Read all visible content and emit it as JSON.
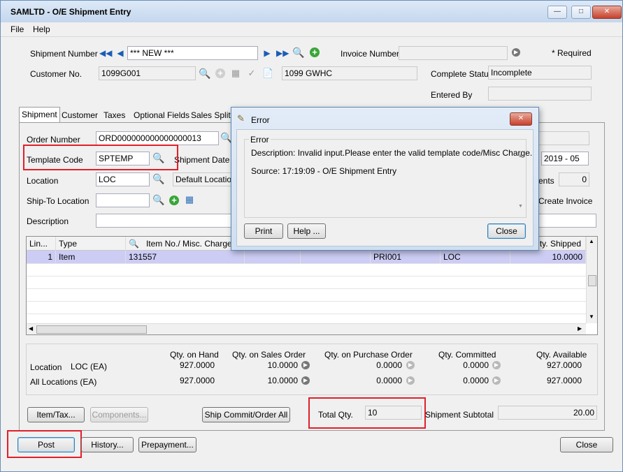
{
  "window": {
    "title": "SAMLTD - O/E Shipment Entry",
    "caption_buttons": [
      "minimize-icon",
      "maximize-icon",
      "close-icon"
    ]
  },
  "menu": {
    "file": "File",
    "help": "Help"
  },
  "header": {
    "shipment_number_label": "Shipment Number",
    "shipment_number_value": "*** NEW ***",
    "invoice_number_label": "Invoice Number",
    "invoice_number_value": "",
    "required_note": "*  Required",
    "customer_no_label": "Customer No.",
    "customer_no_value": "1099G001",
    "customer_name": "1099 GWHC",
    "complete_status_label": "Complete Status",
    "complete_status_value": "Incomplete",
    "entered_by_label": "Entered By",
    "entered_by_value": ""
  },
  "tabs": [
    "Shipment",
    "Customer",
    "Taxes",
    "Optional Fields",
    "Sales Split"
  ],
  "shipment": {
    "order_number_label": "Order Number",
    "order_number_value": "ORD000000000000000013",
    "template_code_label": "Template Code",
    "template_code_value": "SPTEMP",
    "shipment_date_label": "Shipment Date",
    "location_label": "Location",
    "location_value": "LOC",
    "location_desc": "Default Location",
    "ship_to_label": "Ship-To Location",
    "ship_to_value": "",
    "description_label": "Description",
    "description_value": "",
    "year_period": "2019 - 05",
    "comments_label": "ents",
    "comments_value": "0",
    "create_invoice_label": "Create Invoice"
  },
  "grid": {
    "columns": [
      "Lin...",
      "Type",
      "Item No./ Misc. Charge",
      "",
      "",
      "",
      "",
      "ty. Shipped"
    ],
    "rows": [
      {
        "line": "1",
        "type": "Item",
        "item": "131557",
        "c4": "",
        "c5": "",
        "c6": "PRI001",
        "c7": "LOC",
        "shipped": "10.0000"
      }
    ]
  },
  "stats": {
    "headers": [
      "Qty. on Hand",
      "Qty. on Sales Order",
      "Qty. on Purchase Order",
      "Qty. Committed",
      "Qty. Available"
    ],
    "location_label": "Location",
    "location_code": "LOC (EA)",
    "location_values": [
      "927.0000",
      "10.0000",
      "0.0000",
      "0.0000",
      "927.0000"
    ],
    "all_label": "All Locations (EA)",
    "all_values": [
      "927.0000",
      "10.0000",
      "0.0000",
      "0.0000",
      "927.0000"
    ]
  },
  "footer": {
    "item_tax": "Item/Tax...",
    "components": "Components...",
    "ship_commit": "Ship Commit/Order All",
    "total_qty_label": "Total Qty.",
    "total_qty_value": "10",
    "shipment_subtotal_label": "Shipment Subtotal",
    "shipment_subtotal_value": "20.00",
    "post": "Post",
    "history": "History...",
    "prepayment": "Prepayment...",
    "close": "Close"
  },
  "dialog": {
    "title": "Error",
    "group_label": "Error",
    "description": "Description: Invalid input.Please enter the valid template code/Misc Charge.",
    "source": "Source:  17:19:09 - O/E Shipment Entry",
    "print": "Print",
    "help": "Help ...",
    "close": "Close"
  },
  "colors": {
    "highlight_box": "#e0202a",
    "selected_row": "#ccccf5",
    "title_gradient": "#c4d7ee"
  }
}
